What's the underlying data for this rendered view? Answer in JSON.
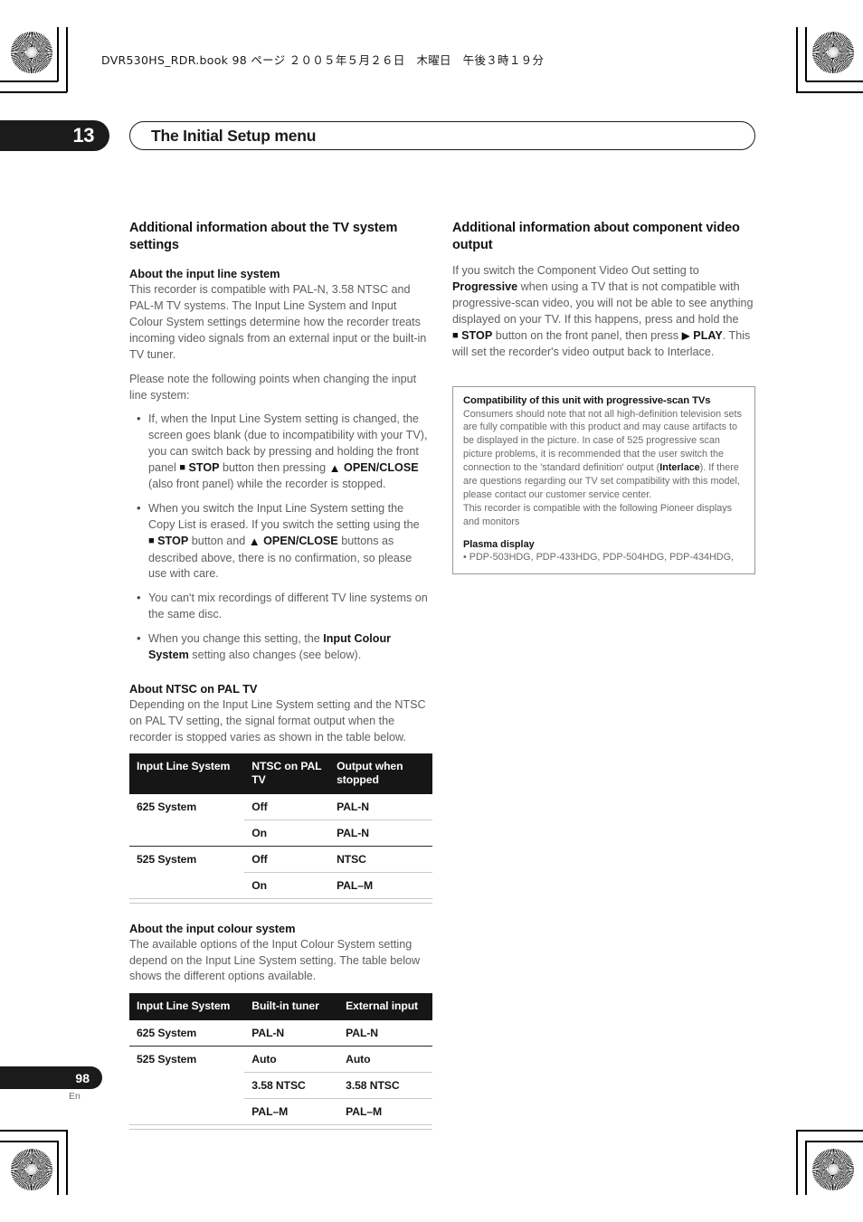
{
  "document": {
    "file_header": "DVR530HS_RDR.book  98 ページ  ２００５年５月２６日　木曜日　午後３時１９分",
    "chapter_number": "13",
    "chapter_title": "The Initial Setup menu",
    "page_number": "98",
    "language_code": "En"
  },
  "left_column": {
    "section_title": "Additional information about the TV system settings",
    "input_line_system": {
      "heading": "About the input line system",
      "paragraph_1": "This recorder is compatible with PAL-N, 3.58 NTSC and PAL-M TV systems. The Input Line System and Input Colour System settings determine how the recorder treats incoming video signals from an external input or the built-in TV tuner.",
      "paragraph_2": "Please note the following points when changing the input line system:",
      "bullets": [
        {
          "part_1": "If, when the Input Line System setting is changed, the screen goes blank (due to incompatibility with your TV), you can switch back by pressing and holding the front panel ",
          "glyph_1": "■",
          "bold_1": "STOP",
          "part_2": " button then pressing ",
          "glyph_2": "▲",
          "bold_2": "OPEN/CLOSE",
          "part_3": " (also front panel) while the recorder is stopped."
        },
        {
          "part_1": "When you switch the Input Line System setting the Copy List is erased. If you switch the setting using the ",
          "glyph_1": "■",
          "bold_1": "STOP",
          "part_2": " button and ",
          "glyph_2": "▲",
          "bold_2": "OPEN/CLOSE",
          "part_3": " buttons as described above, there is no confirmation, so please use with care."
        },
        {
          "part_1": "You can't mix recordings of different TV line systems on the same disc."
        },
        {
          "part_1": "When you change this setting, the ",
          "bold_1": "Input Colour System",
          "part_2": " setting also changes (see below)."
        }
      ]
    },
    "ntsc_on_pal": {
      "heading": "About NTSC on PAL TV",
      "paragraph": "Depending on the Input Line System setting and the NTSC on PAL TV setting, the signal format output when the recorder is stopped varies as shown in the table below.",
      "table": {
        "headers": [
          "Input Line System",
          "NTSC on PAL TV",
          "Output when stopped"
        ],
        "rows": [
          [
            "625 System",
            "Off",
            "PAL-N"
          ],
          [
            "",
            "On",
            "PAL-N"
          ],
          [
            "525 System",
            "Off",
            "NTSC"
          ],
          [
            "",
            "On",
            "PAL–M"
          ]
        ]
      }
    },
    "input_colour_system": {
      "heading": "About the input colour system",
      "paragraph": "The available options of the Input Colour System setting depend on the Input Line System setting. The table below shows the different options available.",
      "table": {
        "headers": [
          "Input Line System",
          "Built-in tuner",
          "External input"
        ],
        "rows": [
          [
            "625 System",
            "PAL-N",
            "PAL-N"
          ],
          [
            "525 System",
            "Auto",
            "Auto"
          ],
          [
            "",
            "3.58 NTSC",
            "3.58 NTSC"
          ],
          [
            "",
            "PAL–M",
            "PAL–M"
          ]
        ]
      }
    }
  },
  "right_column": {
    "section_title": "Additional information about component video output",
    "paragraph": {
      "part_1": "If you switch the Component Video Out setting to ",
      "bold_1": "Progressive",
      "part_2": " when using a TV that is not compatible with progressive-scan video, you will not be able to see anything displayed on your TV. If this happens, press and hold the ",
      "glyph_1": "■",
      "bold_2": "STOP",
      "part_3": " button on the front panel, then press ",
      "glyph_2": "▶",
      "bold_3": "PLAY",
      "part_4": ". This will set the recorder's video output back to Interlace."
    },
    "note_box": {
      "title": "Compatibility of this unit with progressive-scan TVs",
      "body_1": "Consumers should note that not all high-definition television sets are fully compatible with this product and may cause artifacts to be displayed in the picture. In case of 525 progressive scan picture problems, it is recommended that the user switch the connection to the 'standard definition' output (",
      "body_bold": "Interlace",
      "body_2": "). If there are questions regarding our TV set compatibility with this model, please contact our customer service center.",
      "body_3": "This recorder is compatible with the following Pioneer displays and monitors",
      "subhead": "Plasma display",
      "list_item": "• PDP-503HDG, PDP-433HDG, PDP-504HDG, PDP-434HDG,"
    }
  }
}
